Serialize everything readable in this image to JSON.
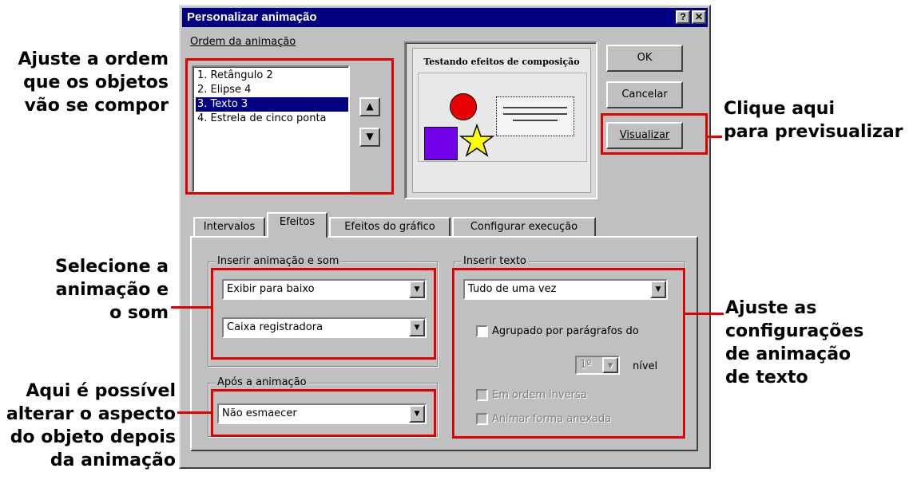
{
  "annotations": {
    "order": [
      "Ajuste a ordem",
      "que os objetos",
      "vão se compor"
    ],
    "preview": [
      "Clique aqui",
      "para previsualizar"
    ],
    "anim_sound": [
      "Selecione a",
      "animação e",
      "o som"
    ],
    "after": [
      "Aqui é possível",
      "alterar o aspecto",
      "do objeto depois",
      "da animação"
    ],
    "text": [
      "Ajuste as",
      "configurações",
      "de animação",
      "de texto"
    ]
  },
  "dialog": {
    "title": "Personalizar animação",
    "help_icon": "?",
    "close_icon": "✕",
    "order_label": "Ordem da animação",
    "order_items": [
      {
        "label": "1. Retângulo 2",
        "selected": false
      },
      {
        "label": "2. Elipse 4",
        "selected": false
      },
      {
        "label": "3. Texto 3",
        "selected": true
      },
      {
        "label": "4. Estrela de cinco ponta",
        "selected": false
      }
    ],
    "move_up_icon": "arrow-up-icon",
    "move_down_icon": "arrow-down-icon",
    "preview_slide_title": "Testando efeitos de composição",
    "buttons": {
      "ok": "OK",
      "cancel": "Cancelar",
      "preview": "Visualizar"
    },
    "tabs": [
      {
        "label": "Intervalos",
        "active": false
      },
      {
        "label": "Efeitos",
        "active": true
      },
      {
        "label": "Efeitos do gráfico",
        "active": false
      },
      {
        "label": "Configurar execução",
        "active": false
      }
    ],
    "insert_anim_group": "Inserir animação e som",
    "effect_combo": "Exibir para baixo",
    "sound_combo": "Caixa registradora",
    "after_group": "Após a animação",
    "after_combo": "Não esmaecer",
    "insert_text_group": "Inserir texto",
    "text_combo": "Tudo de uma vez",
    "grouped_label": "Agrupado por parágrafos do",
    "level_value": "1º",
    "level_label": "nível",
    "reverse_label": "Em ordem inversa",
    "animate_shape_label": "Animar forma anexada"
  },
  "colors": {
    "highlight": "#e00000",
    "titlebar": "#000080",
    "face": "#c0c0c0"
  }
}
